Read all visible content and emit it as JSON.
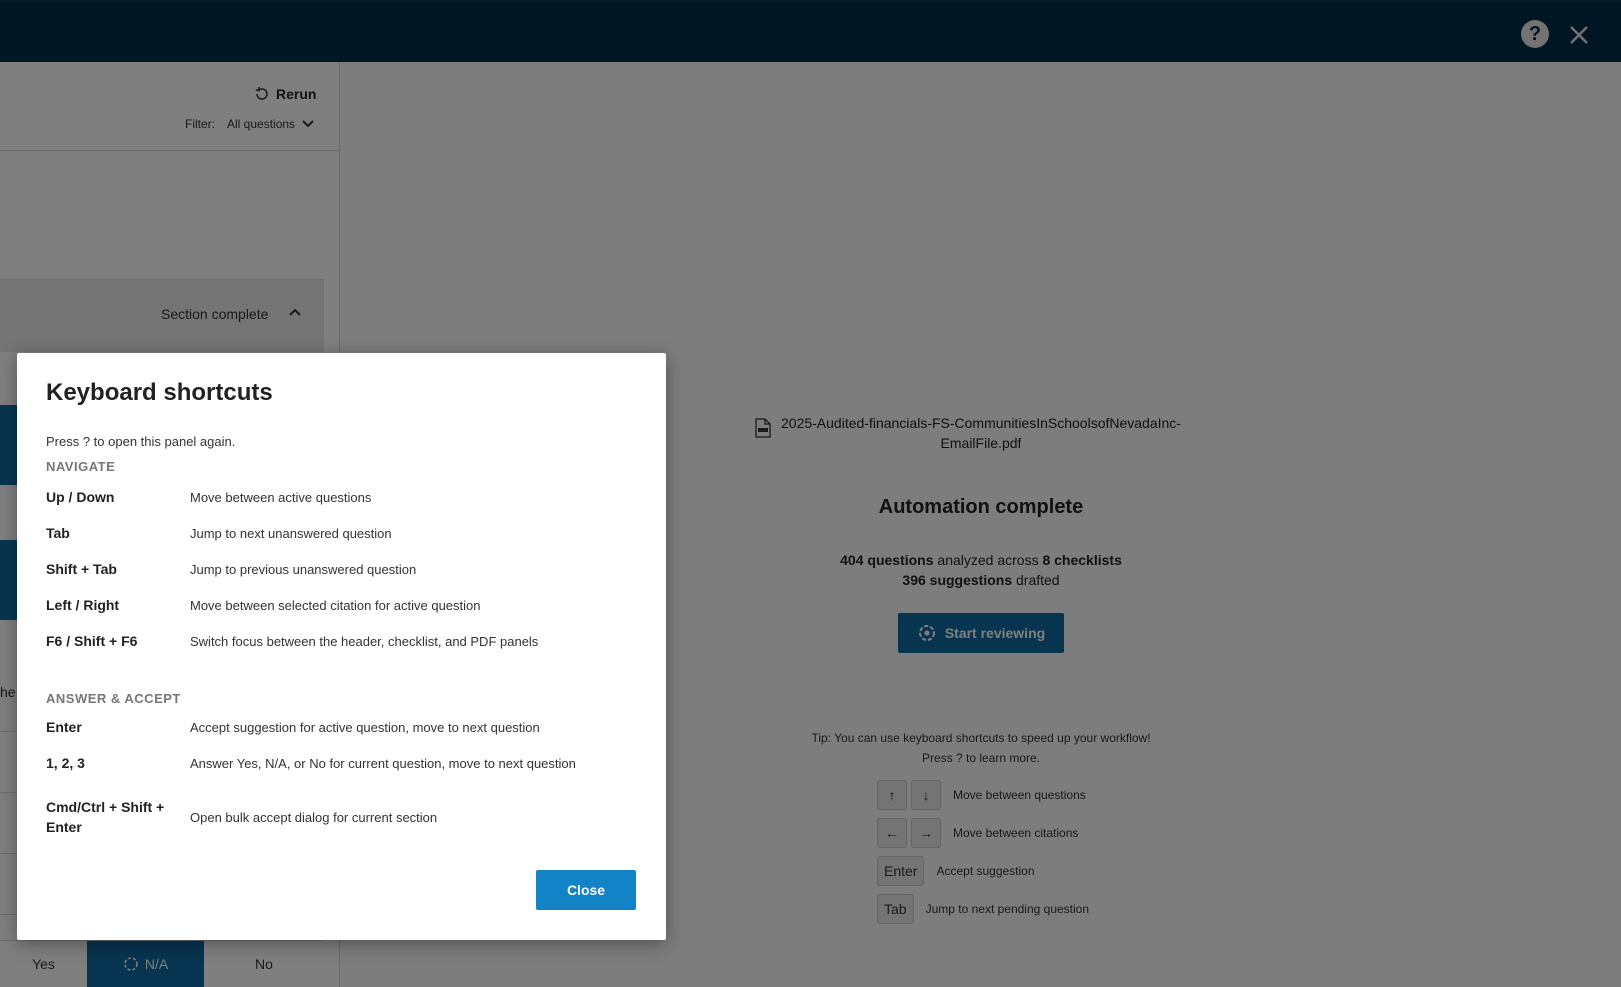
{
  "header": {
    "help_symbol": "?",
    "close_symbol": "✕"
  },
  "left": {
    "rerun_label": "Rerun",
    "filter_label": "Filter:",
    "filter_value": "All questions",
    "section_status": "Section complete",
    "partial_text": "he",
    "answers": {
      "yes": "Yes",
      "na": "N/A",
      "no": "No"
    }
  },
  "right": {
    "filename_line1": "2025-Audited-financials-FS-CommunitiesInSchoolsofNevadaInc-",
    "filename_line2": "EmailFile.pdf",
    "automation_title": "Automation complete",
    "stats": {
      "questions": "404 questions",
      "analyzed_across": " analyzed across ",
      "checklists": "8 checklists",
      "suggestions": "396 suggestions",
      "drafted": " drafted"
    },
    "start_button": "Start reviewing",
    "tip_line1": "Tip: You can use keyboard shortcuts to speed up your workflow!",
    "tip_line2": "Press ? to learn more.",
    "shortcuts": [
      {
        "keys": [
          "↑",
          "↓"
        ],
        "label": "Move between questions"
      },
      {
        "keys": [
          "←",
          "→"
        ],
        "label": "Move between citations"
      },
      {
        "keys": [
          "Enter"
        ],
        "label": "Accept suggestion"
      },
      {
        "keys": [
          "Tab"
        ],
        "label": "Jump to next pending question"
      }
    ]
  },
  "modal": {
    "title": "Keyboard shortcuts",
    "subtitle": "Press ? to open this panel again.",
    "navigate_heading": "NAVIGATE",
    "navigate": [
      {
        "key": "Up / Down",
        "desc": "Move between active questions"
      },
      {
        "key": "Tab",
        "desc": "Jump to next unanswered question"
      },
      {
        "key": "Shift + Tab",
        "desc": "Jump to previous unanswered question"
      },
      {
        "key": "Left / Right",
        "desc": "Move between selected citation for active question"
      },
      {
        "key": "F6 / Shift + F6",
        "desc": "Switch focus between the header, checklist, and PDF panels"
      }
    ],
    "answer_heading": "ANSWER & ACCEPT",
    "answer": [
      {
        "key": "Enter",
        "desc": "Accept suggestion for active question, move to next question"
      },
      {
        "key": "1, 2, 3",
        "desc": "Answer Yes, N/A, or No for current question, move to next question"
      },
      {
        "key": "Cmd/Ctrl + Shift + Enter",
        "desc": "Open bulk accept dialog for current section"
      }
    ],
    "close_button": "Close"
  },
  "colors": {
    "header": "#002c46",
    "accent": "#0e6aa0",
    "modal_button": "#1283c6"
  }
}
